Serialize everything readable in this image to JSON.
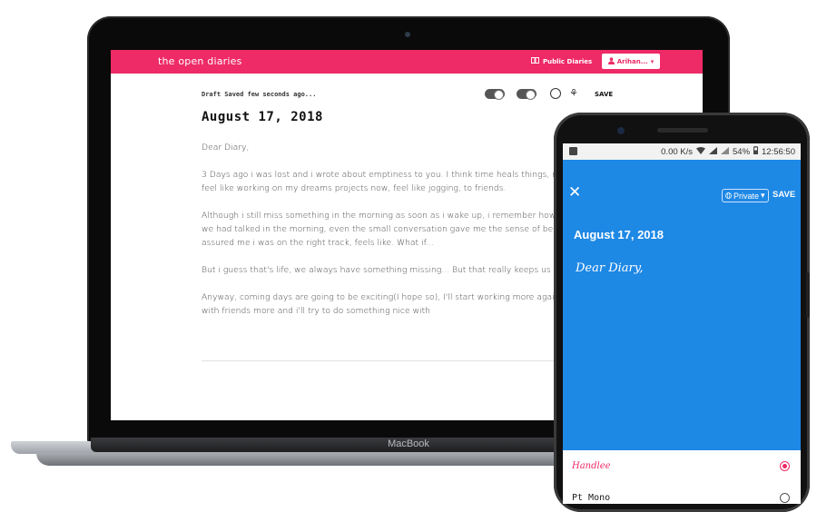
{
  "laptop": {
    "brand_label": "MacBook",
    "app": {
      "brand": "the open diaries",
      "public_diaries": "Public Diaries",
      "user_button": "Arihan...",
      "draft_status": "Draft Saved few seconds ago...",
      "save": "SAVE",
      "date": "August 17, 2018",
      "body": [
        "Dear Diary,",
        "3 Days ago i was lost and i wrote about emptiness to you. I think time heals things, no more emptiness, i feel like working on my dreams projects now, feel like jogging, to friends.",
        "Although i still miss something in the morning as soon as i wake up, i remember how would go just great if we had talked in the morning, even the small conversation gave me the sense of beauty in this world and assured me i was on the right track, feels like. What if...",
        "But i guess that's life, we always have something missing... But that really keeps us lives.",
        "Anyway, coming days are going to be exciting(I hope so), I'll start working more again now, =D. Will go out with friends more and i'll try to do something nice with"
      ]
    }
  },
  "phone": {
    "status": {
      "speed": "0.00 K/s",
      "battery": "54%",
      "time": "12:56:50"
    },
    "private_label": "Private",
    "save": "SAVE",
    "date": "August 17, 2018",
    "body": "Dear Diary,",
    "font_options": [
      {
        "label": "Handlee",
        "selected": true
      },
      {
        "label": "Pt Mono",
        "selected": false
      }
    ]
  },
  "colors": {
    "brand_pink": "#ee2a67",
    "phone_blue": "#1e88e5"
  }
}
